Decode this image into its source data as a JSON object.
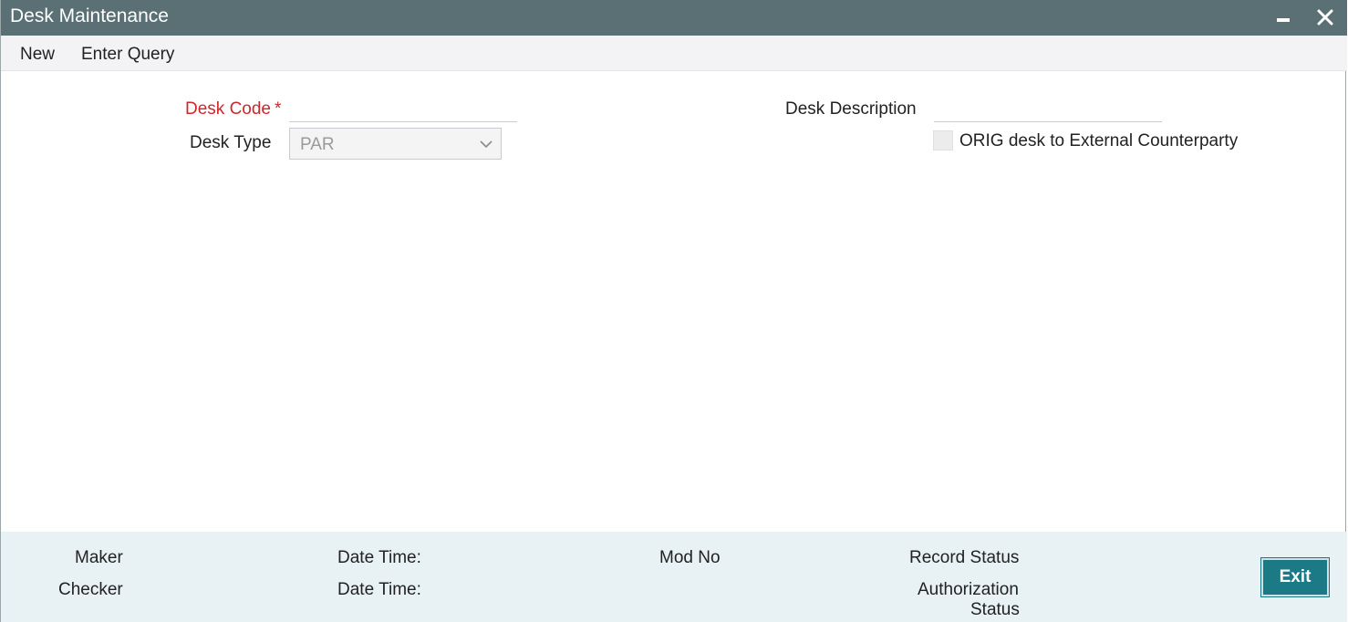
{
  "window": {
    "title": "Desk Maintenance"
  },
  "titlebar_icons": {
    "minimize": "minimize-icon",
    "close": "close-icon"
  },
  "menu": {
    "new_label": "New",
    "enter_query_label": "Enter Query"
  },
  "form": {
    "desk_code": {
      "label": "Desk Code",
      "required_mark": "*",
      "value": ""
    },
    "desk_type": {
      "label": "Desk Type",
      "value": "PAR",
      "icon": "chevron-down-icon"
    },
    "desk_description": {
      "label": "Desk Description",
      "value": ""
    },
    "orig_desk": {
      "label": "ORIG desk to External Counterparty",
      "checked": false
    }
  },
  "footer": {
    "maker_label": "Maker",
    "checker_label": "Checker",
    "date_time_1_label": "Date Time:",
    "date_time_2_label": "Date Time:",
    "mod_no_label": "Mod No",
    "record_status_label": "Record Status",
    "authorization_label_line1": "Authorization",
    "authorization_label_line2": "Status",
    "exit_label": "Exit"
  },
  "colors": {
    "titlebar": "#5a7075",
    "required": "#d0262b",
    "footer_bg": "#e8f2f4",
    "exit_button": "#1b7a86"
  }
}
